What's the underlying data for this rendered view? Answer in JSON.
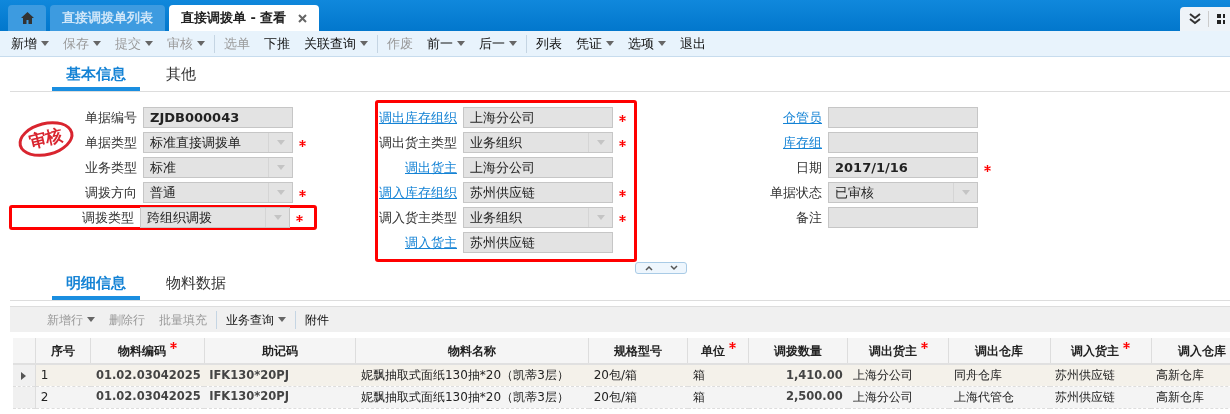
{
  "tabs": [
    {
      "kind": "home",
      "selected": false
    },
    {
      "kind": "page",
      "label": "直接调拨单列表",
      "selected": false,
      "closable": false
    },
    {
      "kind": "page",
      "label": "直接调拨单 - 查看",
      "selected": true,
      "closable": true
    }
  ],
  "toolbar": [
    {
      "kind": "button",
      "label": "新增",
      "disabled": false,
      "dropdown": true
    },
    {
      "kind": "button",
      "label": "保存",
      "disabled": true,
      "dropdown": true
    },
    {
      "kind": "button",
      "label": "提交",
      "disabled": true,
      "dropdown": true
    },
    {
      "kind": "button",
      "label": "审核",
      "disabled": true,
      "dropdown": true
    },
    {
      "kind": "separator"
    },
    {
      "kind": "button",
      "label": "选单",
      "disabled": true,
      "dropdown": false
    },
    {
      "kind": "button",
      "label": "下推",
      "disabled": false,
      "dropdown": false
    },
    {
      "kind": "button",
      "label": "关联查询",
      "disabled": false,
      "dropdown": true
    },
    {
      "kind": "separator"
    },
    {
      "kind": "button",
      "label": "作废",
      "disabled": true,
      "dropdown": false
    },
    {
      "kind": "button",
      "label": "前一",
      "disabled": false,
      "dropdown": true
    },
    {
      "kind": "button",
      "label": "后一",
      "disabled": false,
      "dropdown": true
    },
    {
      "kind": "separator"
    },
    {
      "kind": "button",
      "label": "列表",
      "disabled": false,
      "dropdown": false
    },
    {
      "kind": "button",
      "label": "凭证",
      "disabled": false,
      "dropdown": true
    },
    {
      "kind": "button",
      "label": "选项",
      "disabled": false,
      "dropdown": true
    },
    {
      "kind": "button",
      "label": "退出",
      "disabled": false,
      "dropdown": false
    }
  ],
  "form_tabs": [
    {
      "label": "基本信息",
      "selected": true
    },
    {
      "label": "其他",
      "selected": false
    }
  ],
  "stamp": {
    "text": "审核"
  },
  "form_columns": [
    {
      "highlighted": false,
      "fields": [
        {
          "label": "单据编号",
          "value": "ZJDB000043",
          "link": false,
          "required": false,
          "dropdown": false,
          "highlighted": false
        },
        {
          "label": "单据类型",
          "value": "标准直接调拨单",
          "link": false,
          "required": true,
          "dropdown": true,
          "highlighted": false
        },
        {
          "label": "业务类型",
          "value": "标准",
          "link": false,
          "required": false,
          "dropdown": true,
          "highlighted": false
        },
        {
          "label": "调拨方向",
          "value": "普通",
          "link": false,
          "required": true,
          "dropdown": true,
          "highlighted": false
        },
        {
          "label": "调拨类型",
          "value": "跨组织调拨",
          "link": false,
          "required": true,
          "dropdown": true,
          "highlighted": true
        }
      ]
    },
    {
      "highlighted": true,
      "fields": [
        {
          "label": "调出库存组织",
          "value": "上海分公司",
          "link": true,
          "required": true,
          "dropdown": false,
          "highlighted": false
        },
        {
          "label": "调出货主类型",
          "value": "业务组织",
          "link": false,
          "required": true,
          "dropdown": true,
          "highlighted": false
        },
        {
          "label": "调出货主",
          "value": "上海分公司",
          "link": true,
          "required": false,
          "dropdown": false,
          "highlighted": false
        },
        {
          "label": "调入库存组织",
          "value": "苏州供应链",
          "link": true,
          "required": true,
          "dropdown": false,
          "highlighted": false
        },
        {
          "label": "调入货主类型",
          "value": "业务组织",
          "link": false,
          "required": true,
          "dropdown": true,
          "highlighted": false
        },
        {
          "label": "调入货主",
          "value": "苏州供应链",
          "link": true,
          "required": false,
          "dropdown": false,
          "highlighted": false
        }
      ]
    },
    {
      "highlighted": false,
      "fields": [
        {
          "label": "仓管员",
          "link": true,
          "required": false,
          "dropdown": false,
          "highlighted": false
        },
        {
          "label": "库存组",
          "link": true,
          "required": false,
          "dropdown": false,
          "highlighted": false
        },
        {
          "label": "日期",
          "value": "2017/1/16",
          "link": false,
          "required": true,
          "dropdown": false,
          "highlighted": false
        },
        {
          "label": "单据状态",
          "value": "已审核",
          "link": false,
          "required": false,
          "dropdown": true,
          "highlighted": false
        },
        {
          "label": "备注",
          "link": false,
          "required": false,
          "dropdown": false,
          "highlighted": false
        }
      ]
    }
  ],
  "detail_tabs": [
    {
      "label": "明细信息",
      "selected": true
    },
    {
      "label": "物料数据",
      "selected": false
    }
  ],
  "grid_toolbar": [
    {
      "kind": "button",
      "label": "新增行",
      "disabled": true,
      "dropdown": true
    },
    {
      "kind": "button",
      "label": "删除行",
      "disabled": true,
      "dropdown": false
    },
    {
      "kind": "button",
      "label": "批量填充",
      "disabled": true,
      "dropdown": false
    },
    {
      "kind": "separator"
    },
    {
      "kind": "button",
      "label": "业务查询",
      "disabled": false,
      "dropdown": true
    },
    {
      "kind": "separator"
    },
    {
      "kind": "button",
      "label": "附件",
      "disabled": false,
      "dropdown": false
    }
  ],
  "table": {
    "columns": [
      {
        "label": "序号",
        "required": false,
        "kind": "text"
      },
      {
        "label": "物料编码",
        "required": true,
        "kind": "code"
      },
      {
        "label": "助记码",
        "required": false,
        "kind": "code"
      },
      {
        "label": "物料名称",
        "required": false,
        "kind": "text"
      },
      {
        "label": "规格型号",
        "required": false,
        "kind": "text"
      },
      {
        "label": "单位",
        "required": true,
        "kind": "text"
      },
      {
        "label": "调拨数量",
        "required": false,
        "kind": "number"
      },
      {
        "label": "调出货主",
        "required": true,
        "kind": "text"
      },
      {
        "label": "调出仓库",
        "required": false,
        "kind": "text"
      },
      {
        "label": "调入货主",
        "required": true,
        "kind": "text"
      },
      {
        "label": "调入仓库",
        "required": false,
        "kind": "text"
      }
    ],
    "rows": [
      {
        "current": true,
        "cells": [
          "1",
          "01.02.03042025",
          "IFK130*20PJ",
          "妮飘抽取式面纸130抽*20（凯蒂3层）",
          "20包/箱",
          "箱",
          "1,410.00",
          "上海分公司",
          "同舟仓库",
          "苏州供应链",
          "高新仓库"
        ]
      },
      {
        "current": false,
        "cells": [
          "2",
          "01.02.03042025",
          "IFK130*20PJ",
          "妮飘抽取式面纸130抽*20（凯蒂3层）",
          "20包/箱",
          "箱",
          "2,500.00",
          "上海分公司",
          "上海代管仓",
          "苏州供应链",
          "高新仓库"
        ]
      }
    ]
  }
}
